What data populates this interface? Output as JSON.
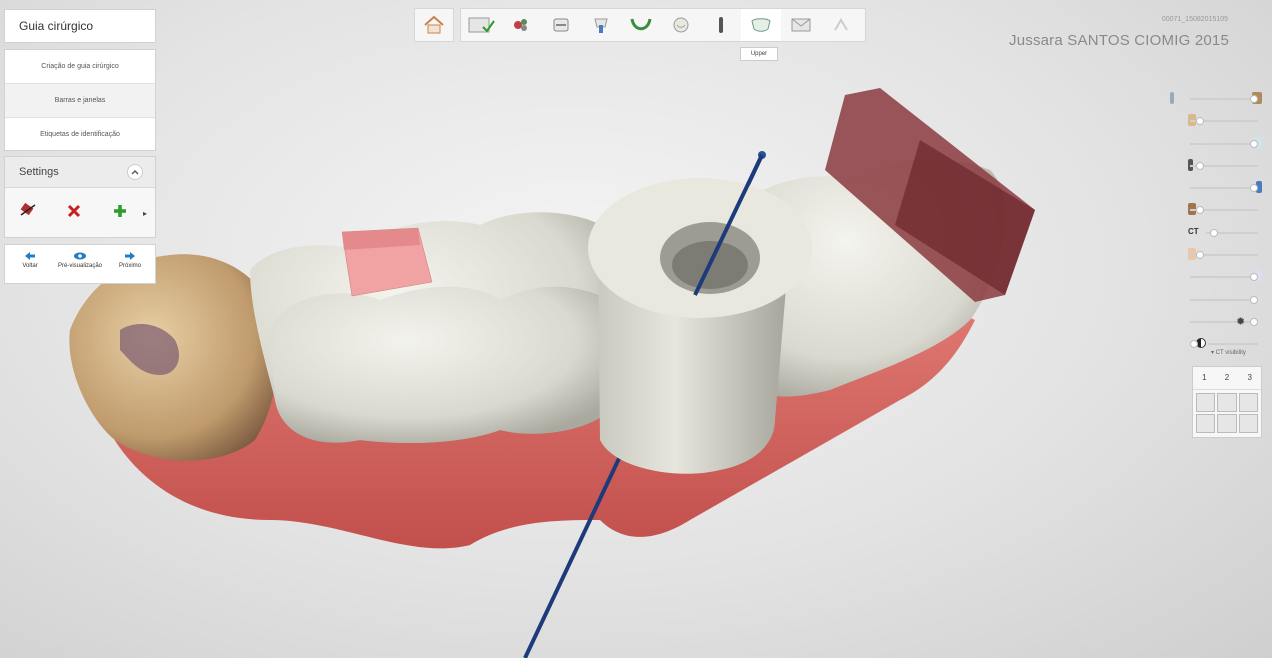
{
  "title_panel": {
    "title": "Guia cirúrgico"
  },
  "menu": {
    "items": [
      {
        "label": "Criação de guia cirúrgico"
      },
      {
        "label": "Barras e janelas"
      },
      {
        "label": "Etiquetas de identificação"
      }
    ]
  },
  "settings": {
    "label": "Settings"
  },
  "nav": {
    "back": "Voltar",
    "preview": "Pré-visualização",
    "next": "Próximo"
  },
  "toolbar": {
    "tooltip": "Upper"
  },
  "header": {
    "case_id": "00071_15082015105",
    "patient": "Jussara SANTOS CIOMIG 2015"
  },
  "right_panel": {
    "ct_label": "CT",
    "ct_visibility": "CT visibility",
    "layouts": [
      "1",
      "2",
      "3"
    ]
  },
  "colors": {
    "gum": "#d86e68",
    "tooth": "#ececE4",
    "implant_axis": "#1d3b7a",
    "bar_pink": "#f0a0a0",
    "bar_dark": "#8a3a3e"
  }
}
